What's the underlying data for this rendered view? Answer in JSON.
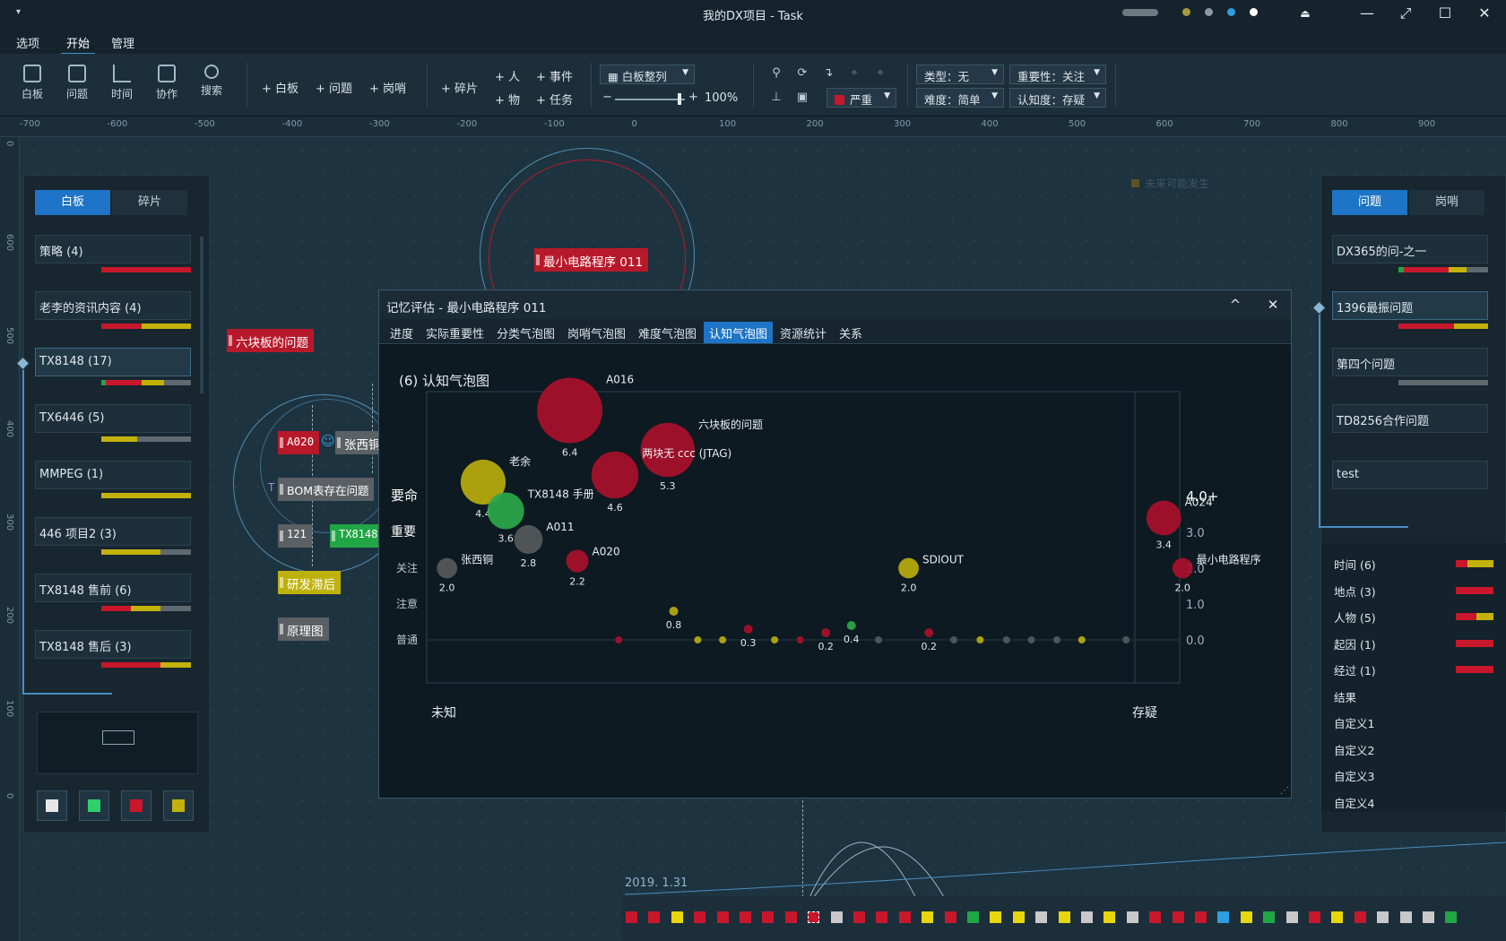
{
  "window": {
    "title": "我的DX项目 - Task",
    "quick_access": "▾",
    "status_dot_colors": [
      "#a99a3e",
      "#8b9aa3",
      "#2f9ee0",
      "#ffffff"
    ],
    "controls": {
      "pin": "⏏",
      "minimize": "—",
      "restore": "⤢",
      "maximize": "☐",
      "close": "✕"
    }
  },
  "menu": {
    "items": [
      "选项",
      "开始",
      "管理"
    ],
    "active": "开始"
  },
  "ribbon": {
    "view_buttons": [
      {
        "label": "白板",
        "icon": "whiteboard-icon"
      },
      {
        "label": "问题",
        "icon": "problem-icon"
      },
      {
        "label": "时间",
        "icon": "timeline-icon"
      },
      {
        "label": "协作",
        "icon": "collaboration-icon"
      },
      {
        "label": "搜索",
        "icon": "search-icon"
      }
    ],
    "add_whiteboard": "+ 白板",
    "add_problem": "+ 问题",
    "add_sentry": "+ 岗哨",
    "add_fragment": "+ 碎片",
    "add_person": "+ 人",
    "add_event": "+ 事件",
    "add_thing": "+ 物",
    "add_task": "+ 任务",
    "arrange": "白板整列",
    "zoom_minus": "−",
    "zoom_plus": "+",
    "zoom_value": "100%",
    "zoom_level": 0.92,
    "severity": "严重",
    "severity_color": "#c8172b",
    "type_filter": "类型：无",
    "importance_filter": "重要性：关注",
    "difficulty_filter": "难度：简单",
    "cognition_filter": "认知度：存疑"
  },
  "rulers": {
    "top": [
      "-700",
      "-600",
      "-500",
      "-400",
      "-300",
      "-200",
      "-100",
      "0",
      "100",
      "200",
      "300",
      "400",
      "500",
      "600",
      "700",
      "800",
      "900"
    ],
    "left": [
      "0",
      "600",
      "500",
      "400",
      "300",
      "200",
      "100",
      "0"
    ]
  },
  "left_panel": {
    "tabs": [
      "白板",
      "碎片"
    ],
    "active_tab": "白板",
    "items": [
      {
        "label": "策略 (4)",
        "bar": [
          [
            "#c8172b",
            1.0
          ]
        ]
      },
      {
        "label": "老李的资讯内容 (4)",
        "bar": [
          [
            "#c8172b",
            0.45
          ],
          [
            "#c3b20b",
            0.55
          ]
        ]
      },
      {
        "label": "TX8148 (17)",
        "bar": [
          [
            "#21a646",
            0.05
          ],
          [
            "#c8172b",
            0.4
          ],
          [
            "#c3b20b",
            0.25
          ],
          [
            "#5e6a70",
            0.3
          ]
        ],
        "selected": true
      },
      {
        "label": "TX6446 (5)",
        "bar": [
          [
            "#c3b20b",
            0.4
          ],
          [
            "#5e6a70",
            0.6
          ]
        ]
      },
      {
        "label": "MMPEG (1)",
        "bar": [
          [
            "#c3b20b",
            1.0
          ]
        ]
      },
      {
        "label": "446 项目2 (3)",
        "bar": [
          [
            "#c3b20b",
            0.66
          ],
          [
            "#5e6a70",
            0.34
          ]
        ]
      },
      {
        "label": "TX8148 售前 (6)",
        "bar": [
          [
            "#c8172b",
            0.33
          ],
          [
            "#c3b20b",
            0.33
          ],
          [
            "#5e6a70",
            0.34
          ]
        ]
      },
      {
        "label": "TX8148 售后 (3)",
        "bar": [
          [
            "#c8172b",
            0.66
          ],
          [
            "#c3b20b",
            0.34
          ]
        ]
      }
    ],
    "swatches": [
      "#e6e6e6",
      "#2fd06a",
      "#c8172b",
      "#c3b20b"
    ]
  },
  "right_panel": {
    "tabs": [
      "问题",
      "岗哨"
    ],
    "active_tab": "问题",
    "items": [
      {
        "label": "DX365的问-之一",
        "bar": [
          [
            "#21a646",
            0.06
          ],
          [
            "#c8172b",
            0.5
          ],
          [
            "#c3b20b",
            0.2
          ],
          [
            "#5e6a70",
            0.24
          ]
        ]
      },
      {
        "label": "1396最振问题",
        "bar": [
          [
            "#c8172b",
            0.62
          ],
          [
            "#c3b20b",
            0.38
          ]
        ],
        "selected": true
      },
      {
        "label": "第四个问题",
        "bar": [
          [
            "#5e6a70",
            1.0
          ]
        ]
      },
      {
        "label": "TD8256合作问题",
        "bar": []
      },
      {
        "label": "test",
        "bar": []
      }
    ],
    "categories": [
      {
        "label": "时间 (6)",
        "bar": [
          [
            "#c8172b",
            0.3
          ],
          [
            "#c3b20b",
            0.7
          ]
        ]
      },
      {
        "label": "地点 (3)",
        "bar": [
          [
            "#c8172b",
            1.0
          ]
        ]
      },
      {
        "label": "人物 (5)",
        "bar": [
          [
            "#c8172b",
            0.55
          ],
          [
            "#c3b20b",
            0.45
          ]
        ]
      },
      {
        "label": "起因 (1)",
        "bar": [
          [
            "#c8172b",
            1.0
          ]
        ]
      },
      {
        "label": "经过 (1)",
        "bar": [
          [
            "#c8172b",
            1.0
          ]
        ]
      },
      {
        "label": "结果",
        "bar": []
      },
      {
        "label": "自定义1",
        "bar": []
      },
      {
        "label": "自定义2",
        "bar": []
      },
      {
        "label": "自定义3",
        "bar": []
      },
      {
        "label": "自定义4",
        "bar": []
      }
    ]
  },
  "canvas_nodes": {
    "min_circuit": "最小电路程序 011",
    "six_boards": "六块板的问题",
    "a020": "A020",
    "zhang": "张西铜",
    "bom": "BOM表存在问题",
    "n121": "121",
    "tx8148": "TX8148",
    "rnd_delay": "研发滞后",
    "schematic": "原理图",
    "faded": [
      "未来可能发生"
    ]
  },
  "dialog": {
    "title": "记忆评估 - 最小电路程序 011",
    "collapse": "^",
    "close": "✕",
    "tabs": [
      "进度",
      "实际重要性",
      "分类气泡图",
      "岗哨气泡图",
      "难度气泡图",
      "认知气泡图",
      "资源统计",
      "关系"
    ],
    "active_tab": "认知气泡图",
    "heading": "(6) 认知气泡图"
  },
  "chart_data": {
    "type": "scatter",
    "title": "(6) 认知气泡图",
    "xlabel_left": "未知",
    "xlabel_right": "存疑",
    "y_category_labels": [
      "普通",
      "注意",
      "关注",
      "重要",
      "要命"
    ],
    "y_tick_labels": [
      "0.0",
      "1.0",
      "2.0",
      "3.0",
      "4.0+"
    ],
    "ylim": [
      0,
      4
    ],
    "xlim": [
      0,
      1
    ],
    "points": [
      {
        "name": "A016",
        "x": 0.19,
        "y": 6.4,
        "size": 6.4,
        "color": "#a8102a",
        "value_label": "6.4"
      },
      {
        "name": "六块板的问题",
        "x": 0.32,
        "y": 5.3,
        "size": 5.3,
        "color": "#a8102a",
        "value_label": "5.3"
      },
      {
        "name": "两块无 ccc (JTAG)",
        "x": 0.25,
        "y": 4.6,
        "size": 4.6,
        "color": "#a8102a",
        "value_label": "4.6"
      },
      {
        "name": "老余",
        "x": 0.075,
        "y": 4.4,
        "size": 4.4,
        "color": "#b9ab0c",
        "value_label": "4.4"
      },
      {
        "name": "TX8148 手册",
        "x": 0.105,
        "y": 3.6,
        "size": 3.6,
        "color": "#2aa84a",
        "value_label": "3.6"
      },
      {
        "name": "A011",
        "x": 0.135,
        "y": 2.8,
        "size": 2.8,
        "color": "#55595c",
        "value_label": "2.8"
      },
      {
        "name": "A020",
        "x": 0.2,
        "y": 2.2,
        "size": 2.2,
        "color": "#a8102a",
        "value_label": "2.2"
      },
      {
        "name": "张西铜",
        "x": 0.027,
        "y": 2.0,
        "size": 2.0,
        "color": "#55595c",
        "value_label": "2.0"
      },
      {
        "name": "SDIOUT",
        "x": 0.64,
        "y": 2.0,
        "size": 2.0,
        "color": "#b9ab0c",
        "value_label": "2.0"
      },
      {
        "name": "A024",
        "x": 0.955,
        "y": 3.4,
        "size": 3.4,
        "color": "#a8102a",
        "value_label": "3.4"
      },
      {
        "name": "最小电路程序",
        "x": 0.98,
        "y": 2.0,
        "size": 2.0,
        "color": "#a8102a",
        "value_label": "2.0"
      },
      {
        "name": "",
        "x": 0.328,
        "y": 0.8,
        "size": 0.8,
        "color": "#b9ab0c",
        "value_label": "0.8"
      },
      {
        "name": "",
        "x": 0.427,
        "y": 0.3,
        "size": 0.3,
        "color": "#a8102a",
        "value_label": "0.3"
      },
      {
        "name": "",
        "x": 0.53,
        "y": 0.2,
        "size": 0.2,
        "color": "#a8102a",
        "value_label": "0.2"
      },
      {
        "name": "",
        "x": 0.564,
        "y": 0.4,
        "size": 0.4,
        "color": "#2aa84a",
        "value_label": "0.4"
      },
      {
        "name": "",
        "x": 0.667,
        "y": 0.2,
        "size": 0.2,
        "color": "#a8102a",
        "value_label": "0.2"
      },
      {
        "name": "",
        "x": 0.255,
        "y": 0,
        "size": 0.1,
        "color": "#a8102a",
        "value_label": ""
      },
      {
        "name": "",
        "x": 0.36,
        "y": 0,
        "size": 0.1,
        "color": "#b9ab0c",
        "value_label": ""
      },
      {
        "name": "",
        "x": 0.393,
        "y": 0,
        "size": 0.1,
        "color": "#b9ab0c",
        "value_label": ""
      },
      {
        "name": "",
        "x": 0.462,
        "y": 0,
        "size": 0.1,
        "color": "#b9ab0c",
        "value_label": ""
      },
      {
        "name": "",
        "x": 0.496,
        "y": 0,
        "size": 0.1,
        "color": "#a8102a",
        "value_label": ""
      },
      {
        "name": "",
        "x": 0.6,
        "y": 0,
        "size": 0.1,
        "color": "#55595c",
        "value_label": ""
      },
      {
        "name": "",
        "x": 0.7,
        "y": 0,
        "size": 0.1,
        "color": "#55595c",
        "value_label": ""
      },
      {
        "name": "",
        "x": 0.735,
        "y": 0,
        "size": 0.1,
        "color": "#b9ab0c",
        "value_label": ""
      },
      {
        "name": "",
        "x": 0.77,
        "y": 0,
        "size": 0.1,
        "color": "#55595c",
        "value_label": ""
      },
      {
        "name": "",
        "x": 0.803,
        "y": 0,
        "size": 0.1,
        "color": "#55595c",
        "value_label": ""
      },
      {
        "name": "",
        "x": 0.837,
        "y": 0,
        "size": 0.1,
        "color": "#55595c",
        "value_label": ""
      },
      {
        "name": "",
        "x": 0.87,
        "y": 0,
        "size": 0.1,
        "color": "#b9ab0c",
        "value_label": ""
      },
      {
        "name": "",
        "x": 0.905,
        "y": 0,
        "size": 0.1,
        "color": "#55595c",
        "value_label": ""
      }
    ]
  },
  "timeline": {
    "date": "2019. 1.31",
    "squares": [
      "#c8172b",
      "#c8172b",
      "#e8d60c",
      "#c8172b",
      "#c8172b",
      "#c8172b",
      "#c8172b",
      "#c8172b",
      "#ffffff",
      "#c9c9c9",
      "#c8172b",
      "#c8172b",
      "#c8172b",
      "#e8d60c",
      "#c8172b",
      "#21a646",
      "#e8d60c",
      "#e8d60c",
      "#c9c9c9",
      "#e8d60c",
      "#c9c9c9",
      "#e8d60c",
      "#c9c9c9",
      "#c8172b",
      "#c8172b",
      "#c8172b",
      "#2f9ee0",
      "#e8d60c",
      "#21a646",
      "#c9c9c9",
      "#c8172b",
      "#e8d60c",
      "#c8172b",
      "#c9c9c9",
      "#c9c9c9",
      "#c9c9c9",
      "#21a646"
    ]
  }
}
